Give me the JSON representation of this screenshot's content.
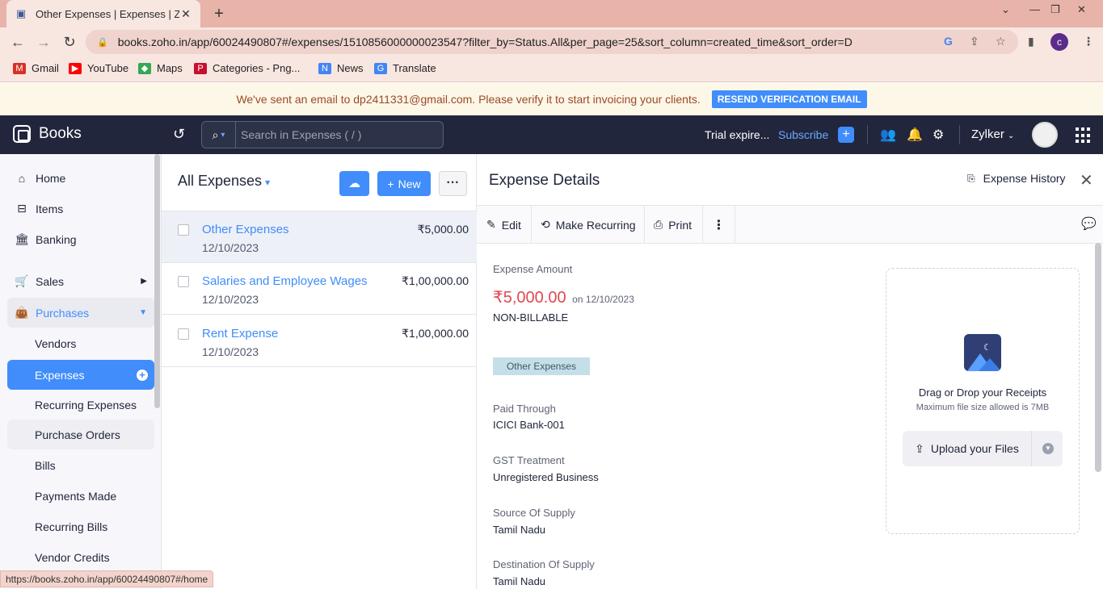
{
  "browser": {
    "tab_title": "Other Expenses | Expenses | Zoho",
    "url": "books.zoho.in/app/60024490807#/expenses/1510856000000023547?filter_by=Status.All&per_page=25&sort_column=created_time&sort_order=D",
    "profile_initial": "c",
    "bookmarks": [
      {
        "label": "Gmail",
        "icon": "gmail-icon",
        "color": "#d93025"
      },
      {
        "label": "YouTube",
        "icon": "youtube-icon",
        "color": "#ff0000"
      },
      {
        "label": "Maps",
        "icon": "maps-icon",
        "color": "#34a853"
      },
      {
        "label": "Categories - Png...",
        "icon": "pinterest-icon",
        "color": "#c8102e"
      },
      {
        "label": "News",
        "icon": "news-icon",
        "color": "#4285f4"
      },
      {
        "label": "Translate",
        "icon": "translate-icon",
        "color": "#4285f4"
      }
    ],
    "status_url": "https://books.zoho.in/app/60024490807#/home"
  },
  "banner": {
    "message": "We've sent an email to dp2411331@gmail.com. Please verify it to start invoicing your clients.",
    "button": "RESEND VERIFICATION EMAIL"
  },
  "header": {
    "brand": "Books",
    "search_placeholder": "Search in Expenses ( / )",
    "trial": "Trial expire...",
    "subscribe": "Subscribe",
    "org": "Zylker"
  },
  "sidebar": {
    "items": [
      {
        "label": "Home",
        "icon": "home-icon"
      },
      {
        "label": "Items",
        "icon": "items-icon"
      },
      {
        "label": "Banking",
        "icon": "bank-icon"
      },
      {
        "label": "Sales",
        "icon": "cart-icon"
      },
      {
        "label": "Purchases",
        "icon": "bag-icon"
      },
      {
        "label": "Vendors"
      },
      {
        "label": "Expenses"
      },
      {
        "label": "Recurring Expenses"
      },
      {
        "label": "Purchase Orders"
      },
      {
        "label": "Bills"
      },
      {
        "label": "Payments Made"
      },
      {
        "label": "Recurring Bills"
      },
      {
        "label": "Vendor Credits"
      }
    ]
  },
  "list": {
    "title": "All Expenses",
    "new_label": "New",
    "rows": [
      {
        "name": "Other Expenses",
        "date": "12/10/2023",
        "amount": "₹5,000.00"
      },
      {
        "name": "Salaries and Employee Wages",
        "date": "12/10/2023",
        "amount": "₹1,00,000.00"
      },
      {
        "name": "Rent Expense",
        "date": "12/10/2023",
        "amount": "₹1,00,000.00"
      }
    ]
  },
  "detail": {
    "title": "Expense Details",
    "history": "Expense History",
    "tools": {
      "edit": "Edit",
      "recurring": "Make Recurring",
      "print": "Print"
    },
    "amount_label": "Expense Amount",
    "amount": "₹5,000.00",
    "on_date": "on 12/10/2023",
    "billable": "NON-BILLABLE",
    "category_tag": "Other Expenses",
    "fields": [
      {
        "label": "Paid Through",
        "value": "ICICI Bank-001"
      },
      {
        "label": "GST Treatment",
        "value": "Unregistered Business"
      },
      {
        "label": "Source Of Supply",
        "value": "Tamil Nadu"
      },
      {
        "label": "Destination Of Supply",
        "value": "Tamil Nadu"
      }
    ],
    "receipt": {
      "title": "Drag or Drop your Receipts",
      "subtitle": "Maximum file size allowed is 7MB",
      "upload": "Upload your Files"
    }
  },
  "colors": {
    "accent": "#408dfb",
    "header_bg": "#21263c",
    "amount_red": "#e0484f"
  }
}
